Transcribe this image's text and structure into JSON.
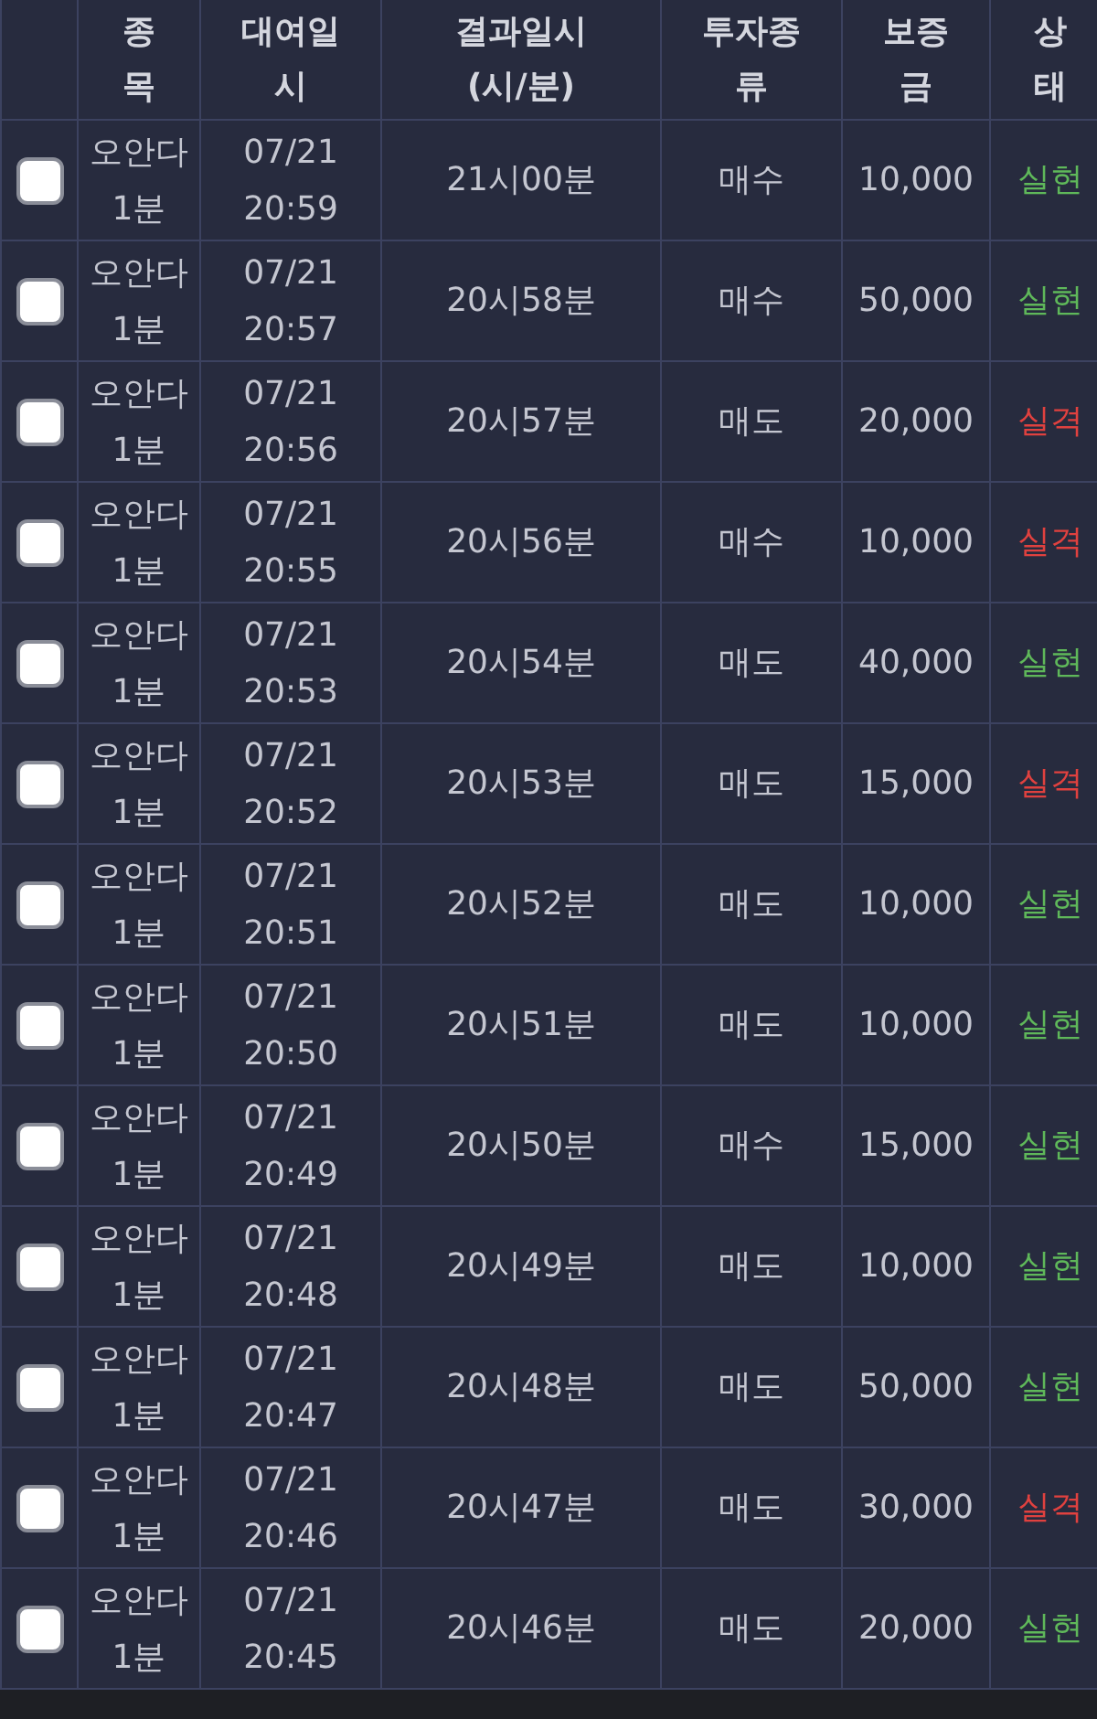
{
  "table": {
    "columns": [
      {
        "lines": [
          "종",
          "목"
        ]
      },
      {
        "lines": [
          "대여일",
          "시"
        ]
      },
      {
        "lines": [
          "결과일시",
          "(시/분)"
        ]
      },
      {
        "lines": [
          "투자종",
          "류"
        ]
      },
      {
        "lines": [
          "보증",
          "금"
        ]
      },
      {
        "lines": [
          "상",
          "태"
        ]
      }
    ],
    "rows": [
      {
        "checked": false,
        "item": "오안다 1분",
        "date": "07/21 20:59",
        "result_time": "21시00분",
        "type": "매수",
        "amount": "10,000",
        "status": "실현",
        "color": "#5fb85a"
      },
      {
        "checked": false,
        "item": "오안다 1분",
        "date": "07/21 20:57",
        "result_time": "20시58분",
        "type": "매수",
        "amount": "50,000",
        "status": "실현",
        "color": "#5fb85a"
      },
      {
        "checked": false,
        "item": "오안다 1분",
        "date": "07/21 20:56",
        "result_time": "20시57분",
        "type": "매도",
        "amount": "20,000",
        "status": "실격",
        "color": "#e0413f"
      },
      {
        "checked": false,
        "item": "오안다 1분",
        "date": "07/21 20:55",
        "result_time": "20시56분",
        "type": "매수",
        "amount": "10,000",
        "status": "실격",
        "color": "#e0413f"
      },
      {
        "checked": false,
        "item": "오안다 1분",
        "date": "07/21 20:53",
        "result_time": "20시54분",
        "type": "매도",
        "amount": "40,000",
        "status": "실현",
        "color": "#5fb85a"
      },
      {
        "checked": false,
        "item": "오안다 1분",
        "date": "07/21 20:52",
        "result_time": "20시53분",
        "type": "매도",
        "amount": "15,000",
        "status": "실격",
        "color": "#e0413f"
      },
      {
        "checked": false,
        "item": "오안다 1분",
        "date": "07/21 20:51",
        "result_time": "20시52분",
        "type": "매도",
        "amount": "10,000",
        "status": "실현",
        "color": "#5fb85a"
      },
      {
        "checked": false,
        "item": "오안다 1분",
        "date": "07/21 20:50",
        "result_time": "20시51분",
        "type": "매도",
        "amount": "10,000",
        "status": "실현",
        "color": "#5fb85a"
      },
      {
        "checked": false,
        "item": "오안다 1분",
        "date": "07/21 20:49",
        "result_time": "20시50분",
        "type": "매수",
        "amount": "15,000",
        "status": "실현",
        "color": "#5fb85a"
      },
      {
        "checked": false,
        "item": "오안다 1분",
        "date": "07/21 20:48",
        "result_time": "20시49분",
        "type": "매도",
        "amount": "10,000",
        "status": "실현",
        "color": "#5fb85a"
      },
      {
        "checked": false,
        "item": "오안다 1분",
        "date": "07/21 20:47",
        "result_time": "20시48분",
        "type": "매도",
        "amount": "50,000",
        "status": "실현",
        "color": "#5fb85a"
      },
      {
        "checked": false,
        "item": "오안다 1분",
        "date": "07/21 20:46",
        "result_time": "20시47분",
        "type": "매도",
        "amount": "30,000",
        "status": "실격",
        "color": "#e0413f"
      },
      {
        "checked": false,
        "item": "오안다 1분",
        "date": "07/21 20:45",
        "result_time": "20시46분",
        "type": "매도",
        "amount": "20,000",
        "status": "실현",
        "color": "#5fb85a"
      }
    ]
  }
}
